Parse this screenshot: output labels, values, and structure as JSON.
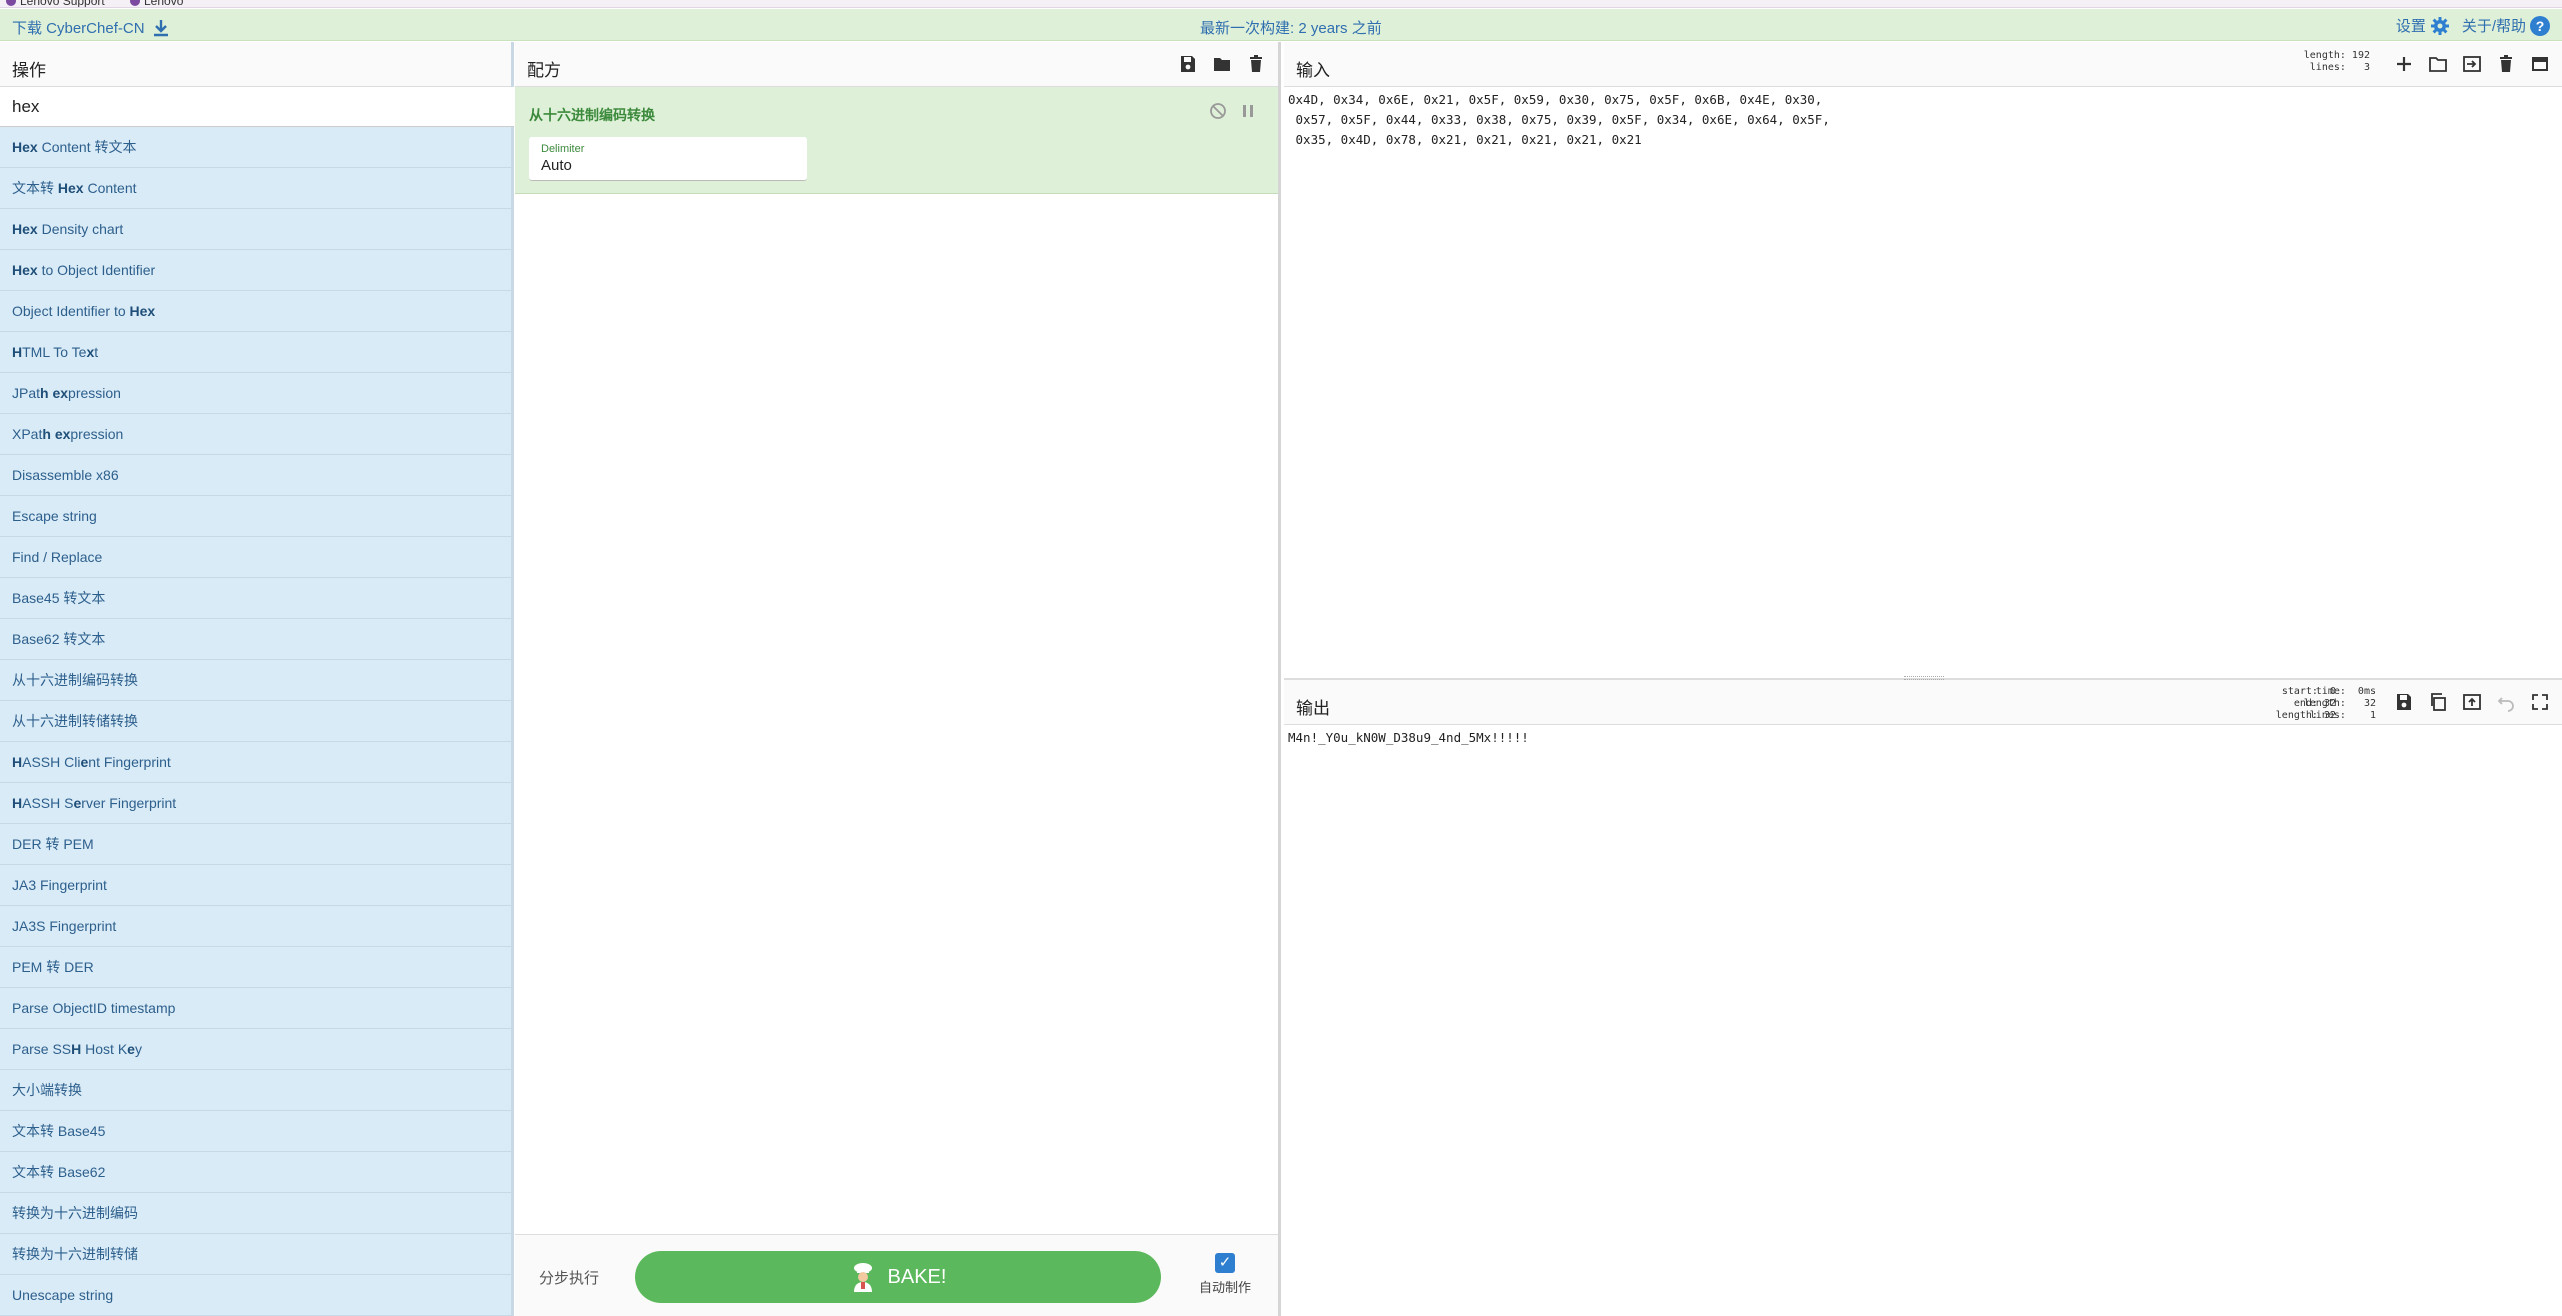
{
  "browser_bookmarks": [
    "Lenovo Support",
    "Lenovo"
  ],
  "banner": {
    "download": "下载 CyberChef-CN",
    "build_prefix": "最新一次构建: ",
    "build_time": "2 years 之前",
    "settings": "设置",
    "about": "关于/帮助"
  },
  "operations": {
    "title": "操作",
    "search_value": "hex",
    "items": [
      {
        "pre": "",
        "bold": "Hex",
        "post": " Content 转文本"
      },
      {
        "pre": "文本转 ",
        "bold": "Hex",
        "post": " Content"
      },
      {
        "pre": "",
        "bold": "Hex",
        "post": " Density chart"
      },
      {
        "pre": "",
        "bold": "Hex",
        "post": " to Object Identifier"
      },
      {
        "pre": "Object Identifier to ",
        "bold": "Hex",
        "post": ""
      },
      {
        "pre": "",
        "bold": "H",
        "post": "TML To Te",
        "bold2": "x",
        "post2": "t"
      },
      {
        "pre": "JPat",
        "bold": "h",
        "post": " ",
        "bold2": "ex",
        "post2": "pression"
      },
      {
        "pre": "XPat",
        "bold": "h",
        "post": " ",
        "bold2": "ex",
        "post2": "pression"
      },
      {
        "pre": "Disassemble x86",
        "bold": "",
        "post": ""
      },
      {
        "pre": "Escape string",
        "bold": "",
        "post": ""
      },
      {
        "pre": "Find / Replace",
        "bold": "",
        "post": ""
      },
      {
        "pre": "Base45 转文本",
        "bold": "",
        "post": ""
      },
      {
        "pre": "Base62 转文本",
        "bold": "",
        "post": ""
      },
      {
        "pre": "从十六进制编码转换",
        "bold": "",
        "post": ""
      },
      {
        "pre": "从十六进制转储转换",
        "bold": "",
        "post": ""
      },
      {
        "pre": "",
        "bold": "H",
        "post": "ASSH Cli",
        "bold2": "e",
        "post2": "nt Fingerprint"
      },
      {
        "pre": "",
        "bold": "H",
        "post": "ASSH S",
        "bold2": "e",
        "post2": "rver Fingerprint"
      },
      {
        "pre": "DER 转 PEM",
        "bold": "",
        "post": ""
      },
      {
        "pre": "JA3 Fingerprint",
        "bold": "",
        "post": ""
      },
      {
        "pre": "JA3S Fingerprint",
        "bold": "",
        "post": ""
      },
      {
        "pre": "PEM 转 DER",
        "bold": "",
        "post": ""
      },
      {
        "pre": "Parse ObjectID timestamp",
        "bold": "",
        "post": ""
      },
      {
        "pre": "Parse SS",
        "bold": "H",
        "post": " Host K",
        "bold2": "e",
        "post2": "y"
      },
      {
        "pre": "大小端转换",
        "bold": "",
        "post": ""
      },
      {
        "pre": "文本转 Base45",
        "bold": "",
        "post": ""
      },
      {
        "pre": "文本转 Base62",
        "bold": "",
        "post": ""
      },
      {
        "pre": "转换为十六进制编码",
        "bold": "",
        "post": ""
      },
      {
        "pre": "转换为十六进制转储",
        "bold": "",
        "post": ""
      },
      {
        "pre": "Unescape string",
        "bold": "",
        "post": ""
      }
    ]
  },
  "recipe": {
    "title": "配方",
    "op_name": "从十六进制编码转换",
    "arg_label": "Delimiter",
    "arg_value": "Auto",
    "step_label": "分步执行",
    "bake_label": "BAKE!",
    "auto_bake_label": "自动制作"
  },
  "input": {
    "title": "输入",
    "stats_length": "length: 192",
    "stats_lines": "lines:   3",
    "text": "0x4D, 0x34, 0x6E, 0x21, 0x5F, 0x59, 0x30, 0x75, 0x5F, 0x6B, 0x4E, 0x30,\n 0x57, 0x5F, 0x44, 0x33, 0x38, 0x75, 0x39, 0x5F, 0x34, 0x6E, 0x64, 0x5F,\n 0x35, 0x4D, 0x78, 0x21, 0x21, 0x21, 0x21, 0x21"
  },
  "output": {
    "title": "输出",
    "stats_col1": "start:  0\n  end: 32\nlength: 32",
    "stats_col2": "  time:  0ms\nlength:   32\n lines:    1",
    "text": "M4n!_Y0u_kN0W_D38u9_4nd_5Mx!!!!!"
  },
  "colors": {
    "banner_bg": "#dff0d8",
    "ops_bg": "#d9ebf6",
    "recipe_op_bg": "#dff0d8",
    "bake_green": "#5cb85c",
    "accent_blue": "#2f7fd0"
  }
}
